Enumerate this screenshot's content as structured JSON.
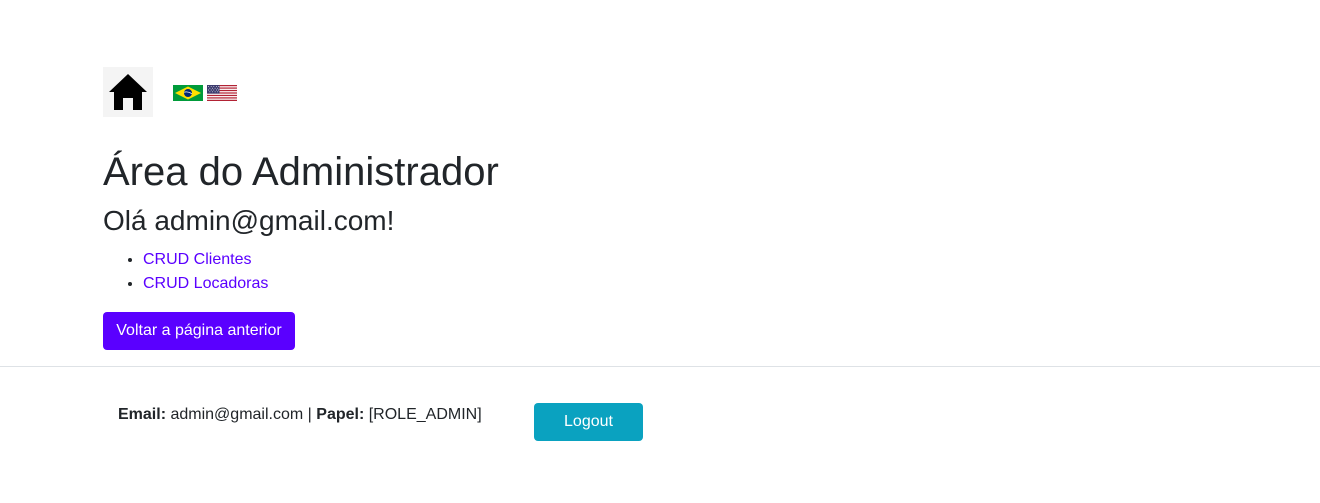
{
  "header": {
    "home_icon": "home-icon",
    "languages": [
      {
        "code": "pt-BR",
        "flag": "brazil-flag-icon"
      },
      {
        "code": "en-US",
        "flag": "usa-flag-icon"
      }
    ]
  },
  "main": {
    "title": "Área do Administrador",
    "greeting": "Olá admin@gmail.com!",
    "links": [
      {
        "label": "CRUD Clientes"
      },
      {
        "label": "CRUD Locadoras"
      }
    ],
    "back_button_label": "Voltar a página anterior"
  },
  "footer": {
    "email_label": "Email:",
    "email_value": "admin@gmail.com",
    "separator": "|",
    "role_label": "Papel:",
    "role_value": "[ROLE_ADMIN]",
    "logout_label": "Logout"
  },
  "colors": {
    "primary": "#5a00ff",
    "info": "#0aa2c0",
    "text": "#212529",
    "divider": "#dee2e6"
  }
}
